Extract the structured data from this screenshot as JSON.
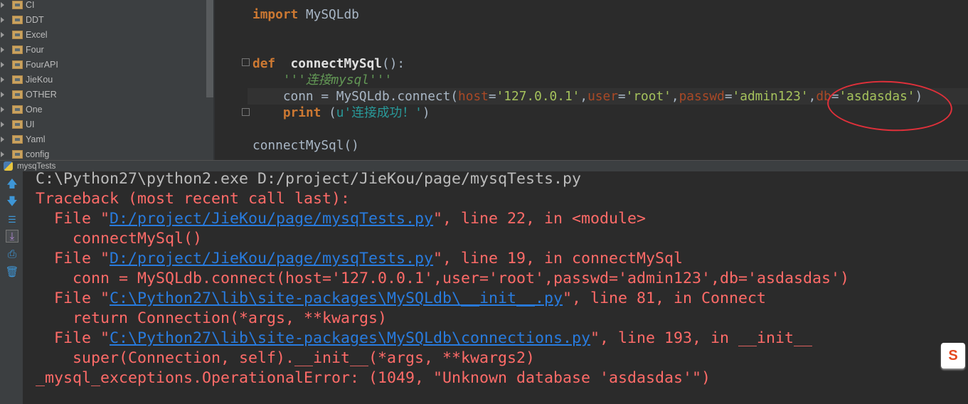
{
  "project_tree": {
    "items": [
      {
        "label": "CI"
      },
      {
        "label": "DDT"
      },
      {
        "label": "Excel"
      },
      {
        "label": "Four"
      },
      {
        "label": "FourAPI"
      },
      {
        "label": "JieKou"
      },
      {
        "label": "OTHER"
      },
      {
        "label": "One"
      },
      {
        "label": "UI"
      },
      {
        "label": "Yaml"
      },
      {
        "label": "config"
      }
    ]
  },
  "editor": {
    "lines": [
      [
        [
          "import",
          "kw"
        ],
        [
          " MySQLdb",
          ""
        ]
      ],
      [],
      [],
      [
        [
          "def",
          "kw"
        ],
        [
          "  ",
          ""
        ],
        [
          "connectMySql",
          "fn"
        ],
        [
          "():",
          ""
        ]
      ],
      [
        [
          "    ",
          ""
        ],
        [
          "'''连接mysql'''",
          "doc"
        ]
      ],
      [
        [
          "    conn = MySQLdb.connect(",
          ""
        ],
        [
          "host",
          "prm"
        ],
        [
          "=",
          ""
        ],
        [
          "'127.0.0.1'",
          "str"
        ],
        [
          ",",
          ""
        ],
        [
          "user",
          "prm"
        ],
        [
          "=",
          ""
        ],
        [
          "'root'",
          "str"
        ],
        [
          ",",
          ""
        ],
        [
          "passwd",
          "prm"
        ],
        [
          "=",
          ""
        ],
        [
          "'admin123'",
          "str"
        ],
        [
          ",",
          ""
        ],
        [
          "db",
          "prm"
        ],
        [
          "=",
          ""
        ],
        [
          "'asdasdas'",
          "str"
        ],
        [
          ")",
          ""
        ]
      ],
      [
        [
          "    ",
          ""
        ],
        [
          "print",
          "kw"
        ],
        [
          " (",
          ""
        ],
        [
          "u'连接成功！'",
          "ustr"
        ],
        [
          ")",
          ""
        ]
      ],
      [],
      [
        [
          "connectMySql()",
          ""
        ]
      ]
    ]
  },
  "run_panel": {
    "title": "mysqTests",
    "toolbar": [
      "up-arrow-icon",
      "down-arrow-icon",
      "soft-wrap-icon",
      "scroll-to-end-icon",
      "print-icon",
      "trash-icon"
    ],
    "output": [
      [
        [
          "C:\\Python27\\python2.exe D:/project/JieKou/page/mysqTests.py",
          ""
        ]
      ],
      [
        [
          "Traceback (most recent call last):",
          ""
        ]
      ],
      [
        [
          "  File \"",
          ""
        ],
        [
          "D:/project/JieKou/page/mysqTests.py",
          "lnk"
        ],
        [
          "\", line 22, in <module>",
          ""
        ]
      ],
      [
        [
          "    connectMySql()",
          ""
        ]
      ],
      [
        [
          "  File \"",
          ""
        ],
        [
          "D:/project/JieKou/page/mysqTests.py",
          "lnk"
        ],
        [
          "\", line 19, in connectMySql",
          ""
        ]
      ],
      [
        [
          "    conn = MySQLdb.connect(host='127.0.0.1',user='root',passwd='admin123',db='asdasdas')",
          ""
        ]
      ],
      [
        [
          "  File \"",
          ""
        ],
        [
          "C:\\Python27\\lib\\site-packages\\MySQLdb\\__init__.py",
          "lnk"
        ],
        [
          "\", line 81, in Connect",
          ""
        ]
      ],
      [
        [
          "    return Connection(*args, **kwargs)",
          ""
        ]
      ],
      [
        [
          "  File \"",
          ""
        ],
        [
          "C:\\Python27\\lib\\site-packages\\MySQLdb\\connections.py",
          "lnk"
        ],
        [
          "\", line 193, in __init__",
          ""
        ]
      ],
      [
        [
          "    super(Connection, self).__init__(*args, **kwargs2)",
          ""
        ]
      ],
      [
        [
          "_mysql_exceptions.OperationalError: (1049, \"Unknown database 'asdasdas'\")",
          ""
        ]
      ]
    ]
  },
  "ime_badge": "S",
  "colors": {
    "annotation_ellipse": "#e0303a",
    "error_text": "#ff6b68",
    "link": "#287bde",
    "keyword": "#cc7832",
    "string": "#a5c25c"
  }
}
